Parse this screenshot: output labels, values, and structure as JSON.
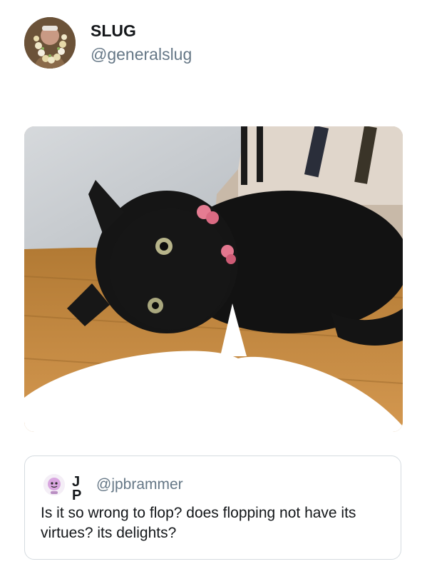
{
  "tweet": {
    "author": {
      "display_name": "SLUG",
      "handle": "@generalslug",
      "avatar_icon": "profile-photo-flower-garland"
    },
    "media": {
      "icon": "black-cat-photo-with-speech-bubble"
    },
    "quoted_tweet": {
      "display_name": "J P",
      "handle": "@jpbrammer",
      "avatar_icon": "cartoon-avatar",
      "text": "Is it so wrong to flop? does flopping not have its virtues? its delights?"
    }
  },
  "colors": {
    "name_text": "#14171a",
    "handle_text": "#657786",
    "card_border": "#d5dbe0",
    "background": "#ffffff"
  }
}
